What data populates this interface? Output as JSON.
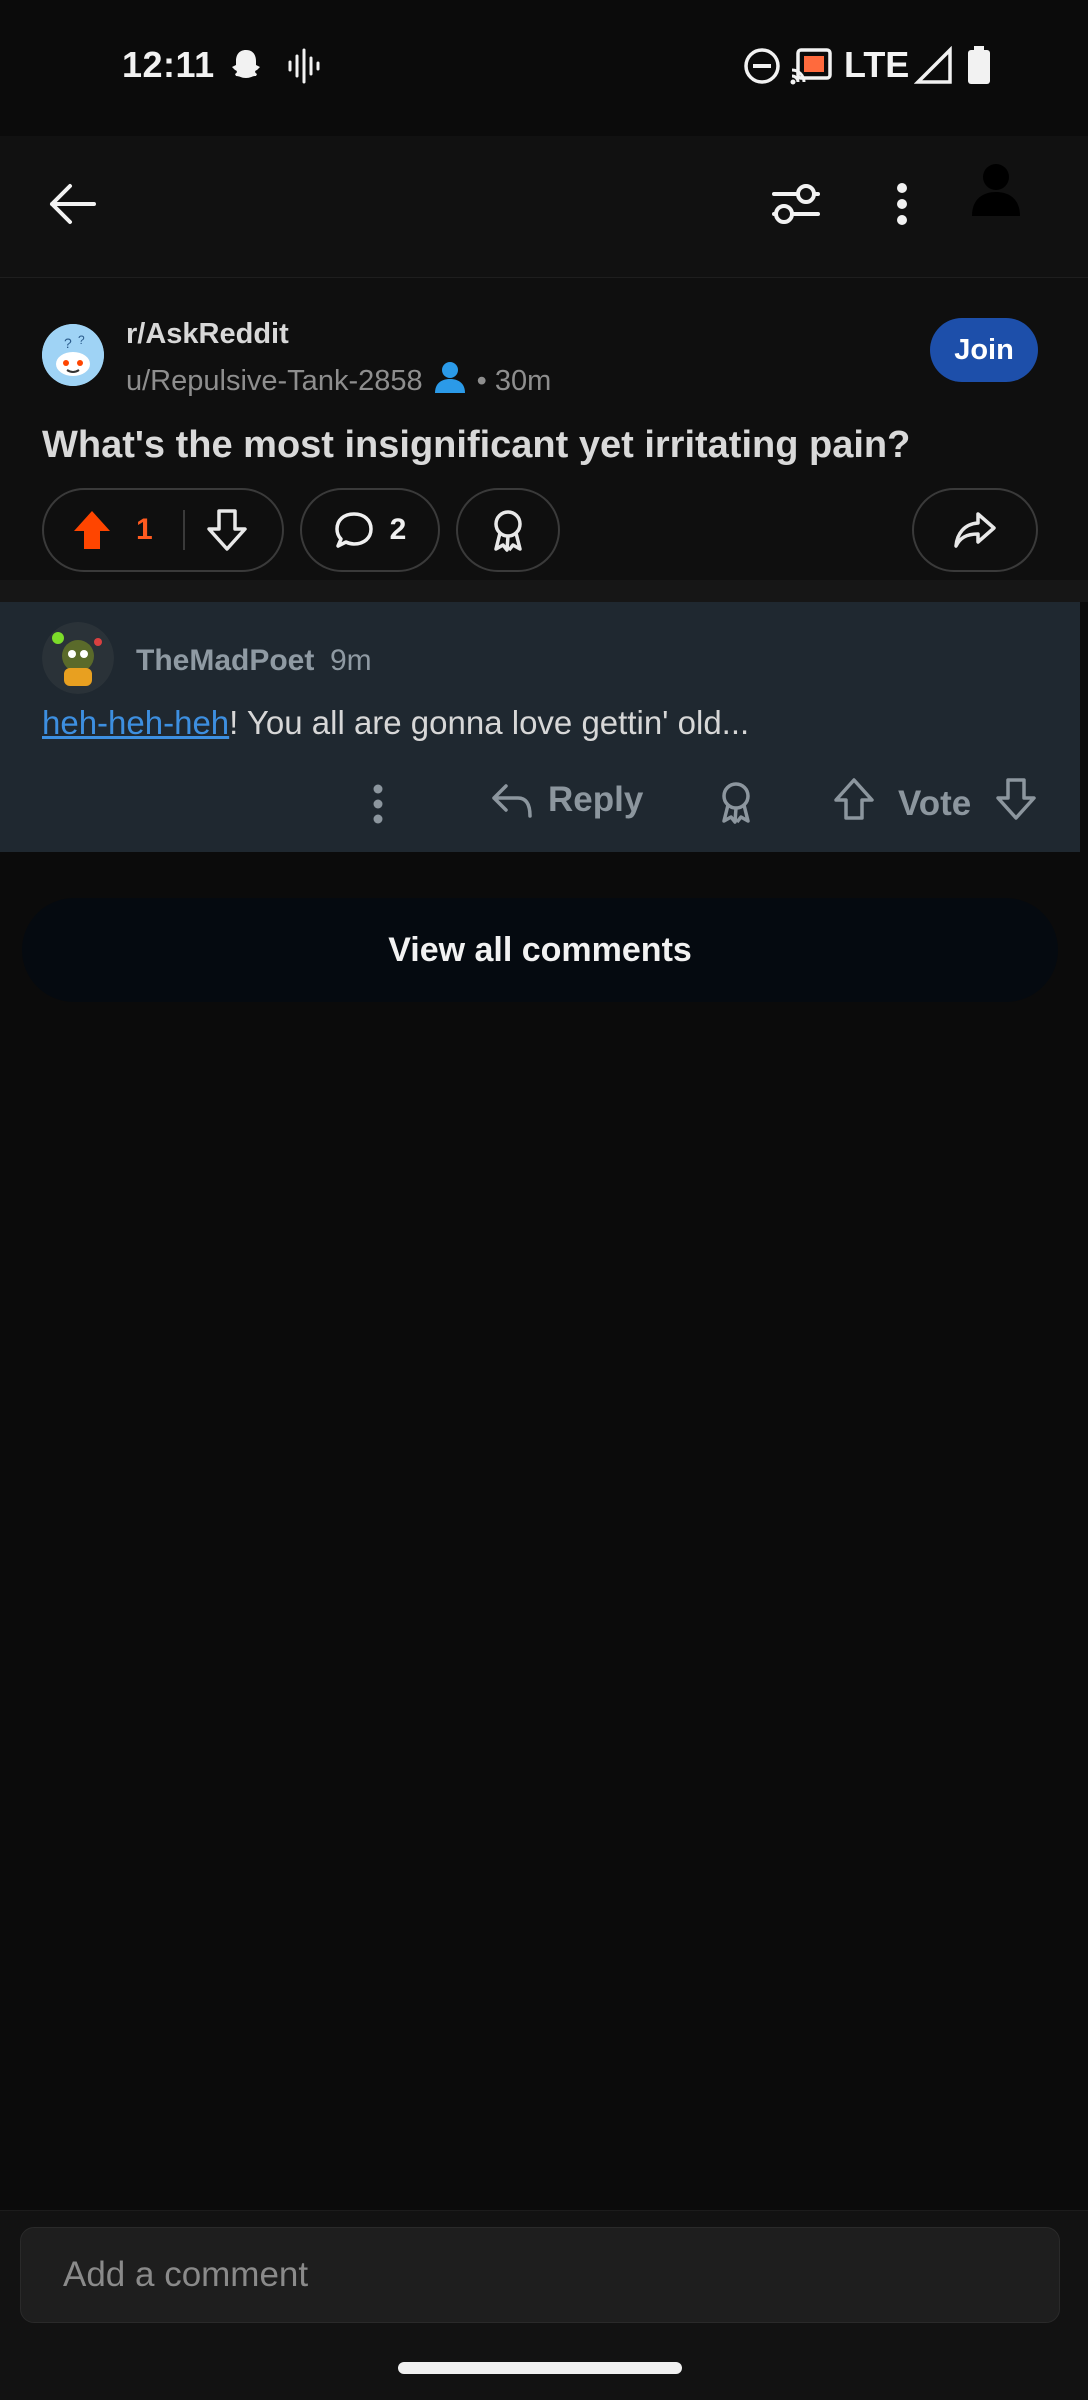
{
  "status_bar": {
    "time": "12:11",
    "network": "LTE",
    "icons": [
      "snapchat-icon",
      "voice-icon",
      "dnd-icon",
      "cast-icon",
      "signal-icon",
      "battery-icon"
    ]
  },
  "app_bar": {
    "icons": [
      "back-arrow-icon",
      "filter-icon",
      "overflow-menu-icon",
      "profile-icon"
    ]
  },
  "post": {
    "subreddit": "r/AskReddit",
    "author": "u/Repulsive-Tank-2858",
    "age": "• 30m",
    "join_label": "Join",
    "title": "What's the most insignificant yet irritating pain?",
    "upvotes": "1",
    "comments": "2"
  },
  "comment": {
    "author": "TheMadPoet",
    "age": "9m",
    "link_text": "heh-heh-heh",
    "body_text": "! You all are gonna love gettin' old...",
    "reply_label": "Reply",
    "vote_label": "Vote"
  },
  "view_all_label": "View all comments",
  "composer": {
    "placeholder": "Add a comment"
  },
  "colors": {
    "upvote": "#ff5a1f",
    "join": "#1d4faa",
    "link": "#3d8fe0",
    "comment_bg": "#1f2830"
  }
}
